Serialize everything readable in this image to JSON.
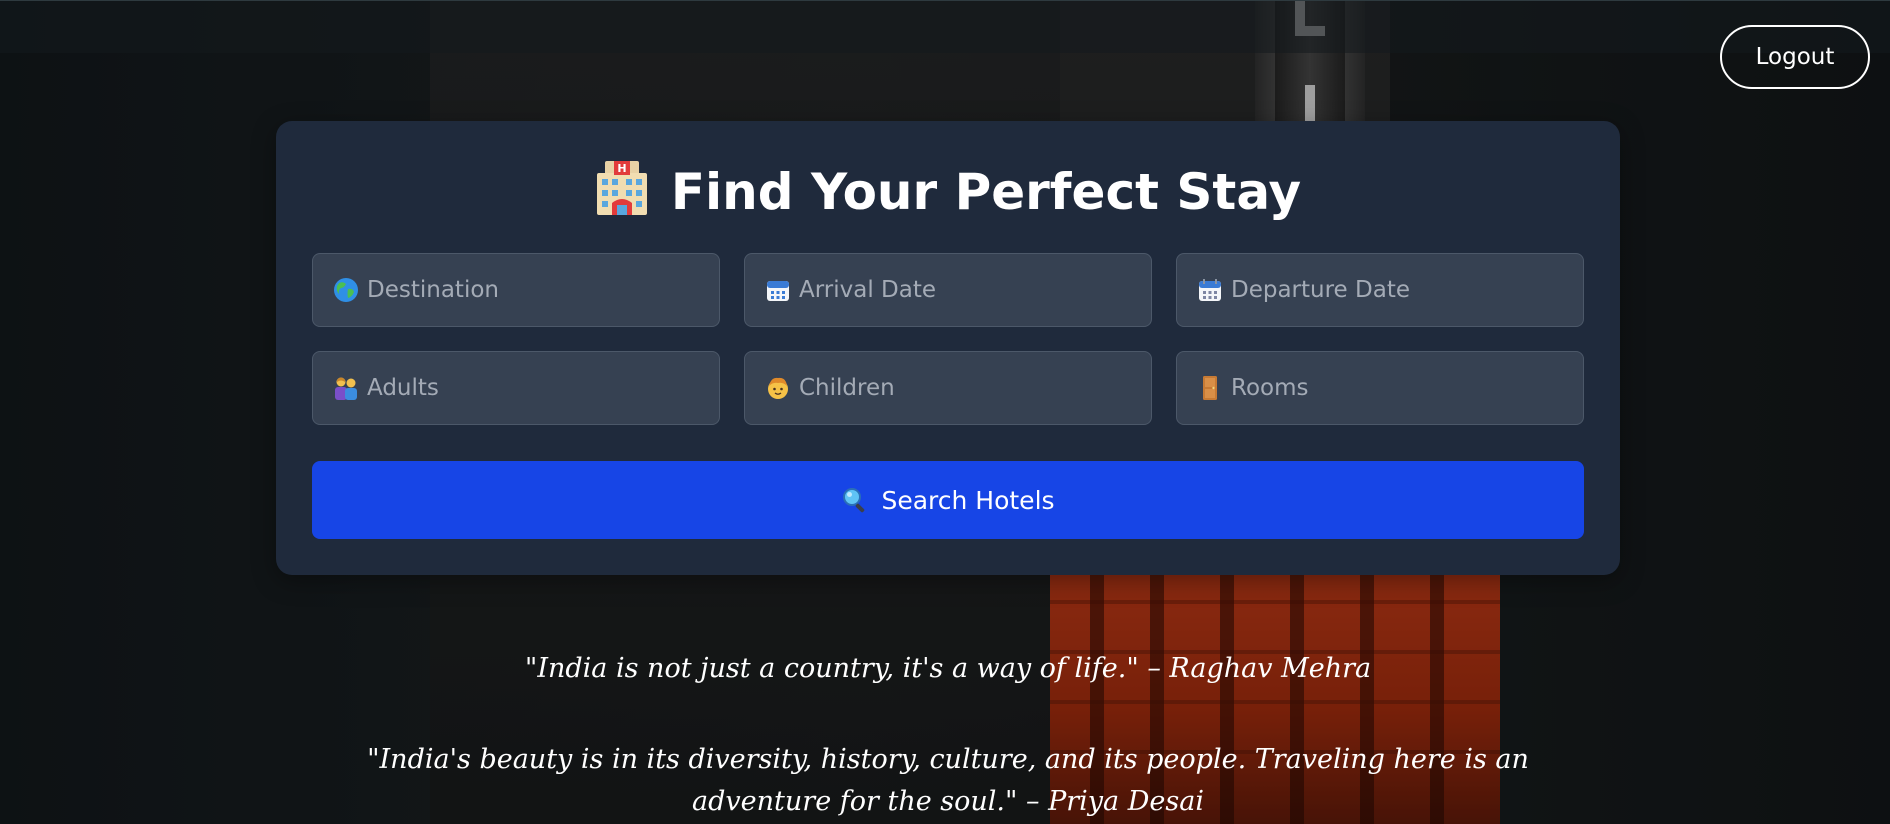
{
  "header": {
    "logout_label": "Logout"
  },
  "search_card": {
    "title": "Find Your Perfect Stay",
    "title_icon": "hotel-icon",
    "fields": {
      "destination": {
        "placeholder": "Destination",
        "icon": "globe-icon"
      },
      "arrival": {
        "placeholder": "Arrival Date",
        "icon": "calendar-icon"
      },
      "departure": {
        "placeholder": "Departure Date",
        "icon": "calendar-icon"
      },
      "adults": {
        "placeholder": "Adults",
        "icon": "couple-icon"
      },
      "children": {
        "placeholder": "Children",
        "icon": "child-icon"
      },
      "rooms": {
        "placeholder": "Rooms",
        "icon": "door-icon"
      }
    },
    "search_button": {
      "label": "Search Hotels",
      "icon": "magnifier-icon"
    }
  },
  "quotes": [
    {
      "text": "\"India is not just a country, it's a way of life.\" – Raghav Mehra"
    },
    {
      "text": "\"India's beauty is in its diversity, history, culture, and its people. Traveling here is an adventure for the soul.\" – Priya Desai"
    }
  ],
  "colors": {
    "card_bg": "#1f2a3c",
    "field_bg": "#364152",
    "button_bg": "#1745e6",
    "text": "#ffffff",
    "placeholder": "#a4abb6"
  }
}
